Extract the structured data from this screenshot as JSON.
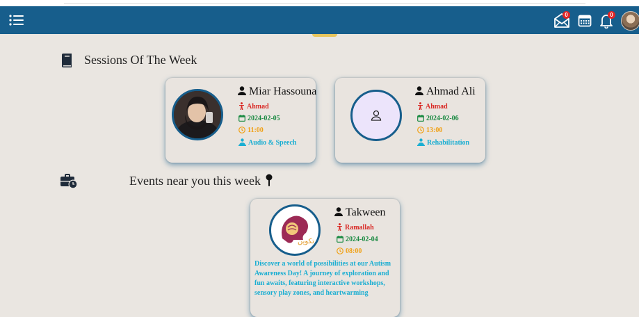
{
  "header": {
    "icons": [
      "list-icon",
      "envelope-icon",
      "calendar-icon",
      "bell-icon"
    ],
    "mail_badge": "0",
    "bell_badge": "0",
    "colors": {
      "bar": "#175e8c",
      "badge": "#e02424"
    }
  },
  "sessions_section": {
    "title": "Sessions Of The Week",
    "icon": "book-icon",
    "cards": [
      {
        "name": "Miar Hassouna",
        "person": "Ahmad",
        "date": "2024-02-05",
        "time": "11:00",
        "department": "Audio & Speech"
      },
      {
        "name": "Ahmad Ali",
        "person": "Ahmad",
        "date": "2024-02-06",
        "time": "13:00",
        "department": "Rehabilitation"
      }
    ]
  },
  "events_section": {
    "title": "Events near you this week",
    "icon": "briefcase-clock-icon",
    "pin_icon": "map-pin-icon",
    "cards": [
      {
        "name": "Takween",
        "location": "Ramallah",
        "date": "2024-02-04",
        "time": "08:00",
        "logo_text": "تكوين",
        "description": "Discover a world of possibilities at our Autism Awareness Day! A journey of exploration and fun awaits, featuring interactive workshops, sensory play zones, and heartwarming"
      }
    ]
  },
  "colors": {
    "background": "#eae6e1",
    "red": "#d92a26",
    "green": "#1a8a42",
    "orange": "#f0a116",
    "cyan": "#1aaed2"
  }
}
